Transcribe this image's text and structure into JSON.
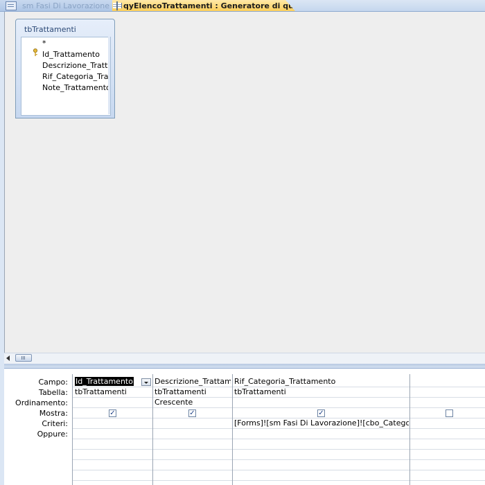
{
  "tabs": [
    {
      "label": "sm Fasi Di Lavorazione",
      "icon": "form-icon",
      "active": false
    },
    {
      "label": "qyElencoTrattamenti : Generatore di query",
      "icon": "query-icon",
      "active": true
    }
  ],
  "table_box": {
    "title": "tbTrattamenti",
    "fields": [
      "*",
      "Id_Trattamento",
      "Descrizione_Trattar",
      "Rif_Categoria_Tratt",
      "Note_Trattamento"
    ],
    "primary_key_field": "Id_Trattamento"
  },
  "grid": {
    "row_labels": [
      "Campo:",
      "Tabella:",
      "Ordinamento:",
      "Mostra:",
      "Criteri:",
      "Oppure:"
    ],
    "columns": [
      {
        "campo": "Id_Trattamento",
        "tabella": "tbTrattamenti",
        "ordinamento": "",
        "mostra": true,
        "criteri": "",
        "selected": true
      },
      {
        "campo": "Descrizione_Trattamen",
        "tabella": "tbTrattamenti",
        "ordinamento": "Crescente",
        "mostra": true,
        "criteri": ""
      },
      {
        "campo": "Rif_Categoria_Trattamento",
        "tabella": "tbTrattamenti",
        "ordinamento": "",
        "mostra": true,
        "criteri": "[Forms]![sm Fasi Di Lavorazione]![cbo_Categoria]"
      },
      {
        "campo": "",
        "tabella": "",
        "ordinamento": "",
        "mostra": false,
        "criteri": ""
      }
    ]
  },
  "colors": {
    "active_tab": "#fdcf5b",
    "upper_pane_bg": "#eeeeee",
    "table_header": "#c7d8f0",
    "grid_border": "#9aa5b3"
  }
}
